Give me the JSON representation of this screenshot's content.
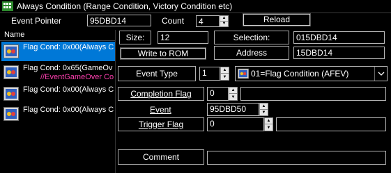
{
  "window": {
    "title": "Always Condition (Range Condition, Victory Condition etc)"
  },
  "toolbar": {
    "event_pointer_label": "Event Pointer",
    "event_pointer_value": "95DBD14",
    "count_label": "Count",
    "count_value": "4",
    "reload_label": "Reload"
  },
  "list": {
    "header": "Name",
    "items": [
      {
        "line1": "Flag Cond:  0x00(Always C",
        "line2": ""
      },
      {
        "line1": "Flag Cond:  0x65(GameOv",
        "line2": "//EventGameOver Co"
      },
      {
        "line1": "Flag Cond:  0x00(Always C",
        "line2": ""
      },
      {
        "line1": "Flag Cond:  0x00(Always C",
        "line2": ""
      }
    ],
    "selected_index": 0
  },
  "detail": {
    "size_label": "Size:",
    "size_value": "12",
    "selection_label": "Selection:",
    "selection_value": "015DBD14",
    "write_to_rom_label": "Write to ROM",
    "address_label": "Address",
    "address_value": "15DBD14",
    "event_type_label": "Event Type",
    "event_type_value": "1",
    "event_type_selected": "01=Flag Condition (AFEV)",
    "completion_flag_label": "Completion Flag",
    "completion_flag_value": "0",
    "completion_flag_desc": "",
    "event_label": "Event",
    "event_value": "95DBD50",
    "trigger_flag_label": "Trigger Flag",
    "trigger_flag_value": "0",
    "trigger_flag_desc": "",
    "comment_label": "Comment",
    "comment_value": ""
  },
  "colors": {
    "selection": "#0078d7",
    "comment_text": "#ff3fb0",
    "background": "#000000"
  }
}
